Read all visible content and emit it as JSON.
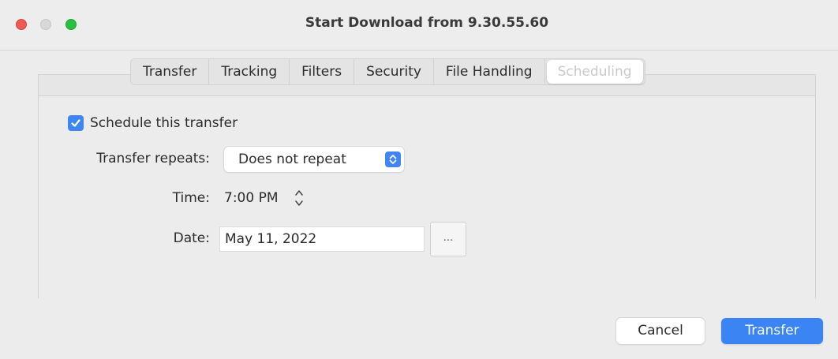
{
  "window": {
    "title": "Start Download from 9.30.55.60"
  },
  "tabs": [
    {
      "label": "Transfer"
    },
    {
      "label": "Tracking"
    },
    {
      "label": "Filters"
    },
    {
      "label": "Security"
    },
    {
      "label": "File Handling"
    },
    {
      "label": "Scheduling",
      "active": true
    }
  ],
  "schedule": {
    "checkbox_label": "Schedule this transfer",
    "checked": true,
    "repeats_label": "Transfer repeats:",
    "repeats_value": "Does not repeat",
    "time_label": "Time:",
    "time_value": "7:00 PM",
    "date_label": "Date:",
    "date_value": "May 11, 2022",
    "date_button": "..."
  },
  "buttons": {
    "cancel": "Cancel",
    "transfer": "Transfer"
  },
  "colors": {
    "accent": "#3a84f3",
    "close": "#ee5b57",
    "zoom": "#28c13f"
  }
}
